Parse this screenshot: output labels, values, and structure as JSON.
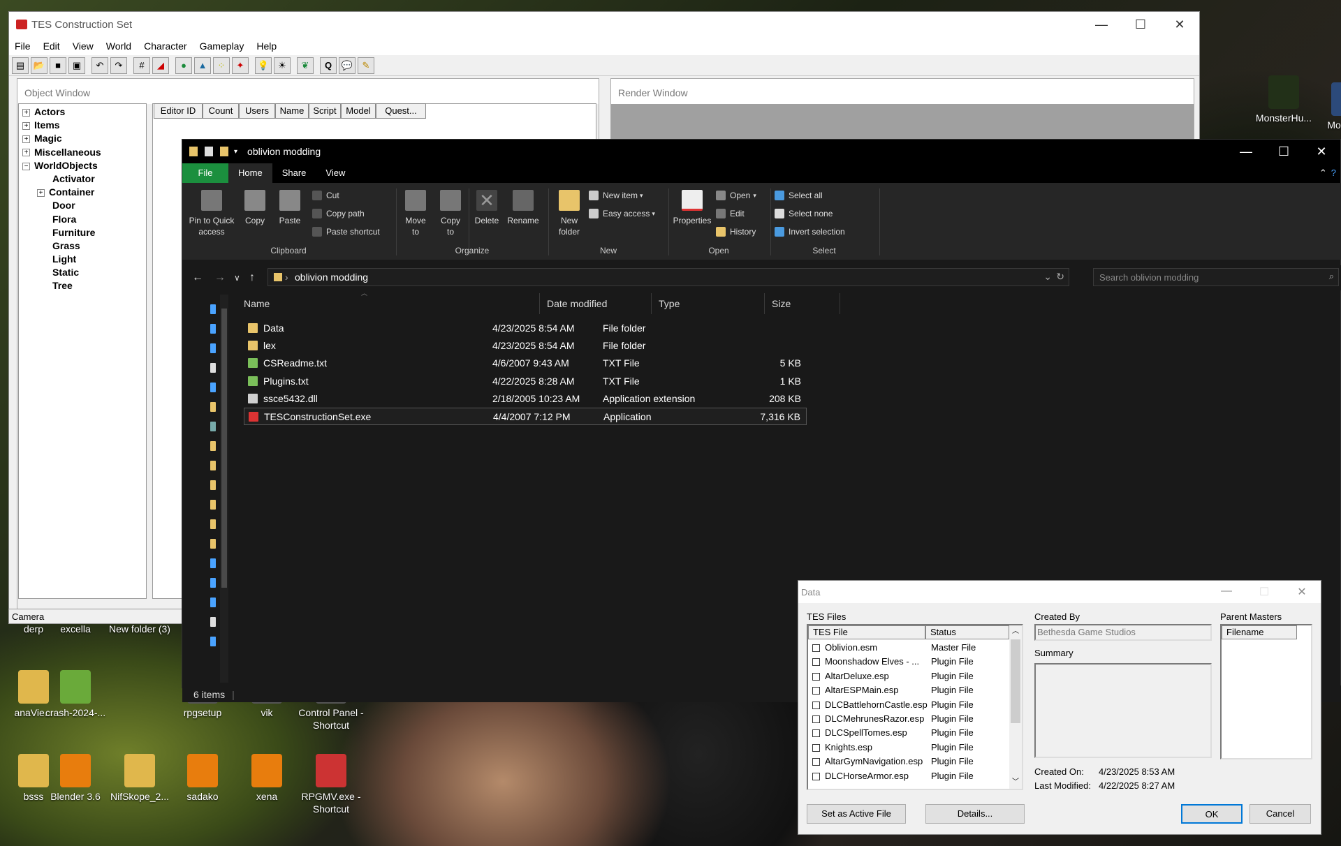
{
  "desktop": {
    "icons": [
      {
        "label": "MonsterHu...",
        "color": "#223018"
      },
      {
        "label": "Mons Sh",
        "color": "#2c4a7a"
      },
      {
        "label": "derp",
        "color": "#444"
      },
      {
        "label": "excella",
        "color": "#555"
      },
      {
        "label": "New folder (3)",
        "color": "#e0b74c"
      },
      {
        "label": "anaVie...",
        "color": "#e0b74c"
      },
      {
        "label": "crash-2024-...",
        "color": "#6aaa3a"
      },
      {
        "label": "rpgsetup",
        "color": "#555"
      },
      {
        "label": "vik",
        "color": "#555"
      },
      {
        "label": "Control Panel - Shortcut",
        "color": "#555"
      },
      {
        "label": "bsss",
        "color": "#e0b74c"
      },
      {
        "label": "Blender 3.6",
        "color": "#e87d0d"
      },
      {
        "label": "NifSkope_2...",
        "color": "#e0b74c"
      },
      {
        "label": "sadako",
        "color": "#e87d0d"
      },
      {
        "label": "xena",
        "color": "#e87d0d"
      },
      {
        "label": "RPGMV.exe - Shortcut",
        "color": "#c33"
      }
    ]
  },
  "tes": {
    "title": "TES Construction Set",
    "menu": [
      "File",
      "Edit",
      "View",
      "World",
      "Character",
      "Gameplay",
      "Help"
    ],
    "object_window_title": "Object Window",
    "render_window_title": "Render Window",
    "tree": [
      {
        "label": "Actors",
        "pm": "+",
        "child": false
      },
      {
        "label": "Items",
        "pm": "+",
        "child": false
      },
      {
        "label": "Magic",
        "pm": "+",
        "child": false
      },
      {
        "label": "Miscellaneous",
        "pm": "+",
        "child": false
      },
      {
        "label": "WorldObjects",
        "pm": "−",
        "child": false
      },
      {
        "label": "Activator",
        "pm": "",
        "child": true
      },
      {
        "label": "Container",
        "pm": "+",
        "child": true
      },
      {
        "label": "Door",
        "pm": "",
        "child": true
      },
      {
        "label": "Flora",
        "pm": "",
        "child": true
      },
      {
        "label": "Furniture",
        "pm": "",
        "child": true
      },
      {
        "label": "Grass",
        "pm": "",
        "child": true
      },
      {
        "label": "Light",
        "pm": "",
        "child": true
      },
      {
        "label": "Static",
        "pm": "",
        "child": true
      },
      {
        "label": "Tree",
        "pm": "",
        "child": true
      }
    ],
    "columns": [
      "Editor ID",
      "Count",
      "Users",
      "Name",
      "Script",
      "Model",
      "Quest..."
    ],
    "status_camera": "Camera"
  },
  "explorer": {
    "title": "oblivion modding",
    "tabs": [
      "File",
      "Home",
      "Share",
      "View"
    ],
    "ribbon": {
      "pin": "Pin to Quick access",
      "copy": "Copy",
      "paste": "Paste",
      "cut": "Cut",
      "copy_path": "Copy path",
      "paste_shortcut": "Paste shortcut",
      "clipboard": "Clipboard",
      "move_to": "Move to",
      "copy_to": "Copy to",
      "delete": "Delete",
      "rename": "Rename",
      "organize": "Organize",
      "new_folder": "New folder",
      "new_item": "New item",
      "easy_access": "Easy access",
      "new": "New",
      "properties": "Properties",
      "open": "Open",
      "edit": "Edit",
      "history": "History",
      "open_group": "Open",
      "select_all": "Select all",
      "select_none": "Select none",
      "invert_selection": "Invert selection",
      "select_group": "Select"
    },
    "address": "oblivion modding",
    "search_placeholder": "Search oblivion modding",
    "headers": {
      "name": "Name",
      "date": "Date modified",
      "type": "Type",
      "size": "Size"
    },
    "files": [
      {
        "name": "Data",
        "date": "4/23/2025 8:54 AM",
        "type": "File folder",
        "size": "",
        "icon": "#e8c46a"
      },
      {
        "name": "lex",
        "date": "4/23/2025 8:54 AM",
        "type": "File folder",
        "size": "",
        "icon": "#e8c46a"
      },
      {
        "name": "CSReadme.txt",
        "date": "4/6/2007 9:43 AM",
        "type": "TXT File",
        "size": "5 KB",
        "icon": "#7bbf5a"
      },
      {
        "name": "Plugins.txt",
        "date": "4/22/2025 8:28 AM",
        "type": "TXT File",
        "size": "1 KB",
        "icon": "#7bbf5a"
      },
      {
        "name": "ssce5432.dll",
        "date": "2/18/2005 10:23 AM",
        "type": "Application extension",
        "size": "208 KB",
        "icon": "#cfcfcf"
      },
      {
        "name": "TESConstructionSet.exe",
        "date": "4/4/2007 7:12 PM",
        "type": "Application",
        "size": "7,316 KB",
        "icon": "#d33"
      }
    ],
    "status": "6 items"
  },
  "dialog": {
    "title": "Data",
    "tes_files_label": "TES Files",
    "col_file": "TES File",
    "col_status": "Status",
    "files": [
      {
        "name": "Oblivion.esm",
        "status": "Master File"
      },
      {
        "name": "Moonshadow Elves - ...",
        "status": "Plugin File"
      },
      {
        "name": "AltarDeluxe.esp",
        "status": "Plugin File"
      },
      {
        "name": "AltarESPMain.esp",
        "status": "Plugin File"
      },
      {
        "name": "DLCBattlehornCastle.esp",
        "status": "Plugin File"
      },
      {
        "name": "DLCMehrunesRazor.esp",
        "status": "Plugin File"
      },
      {
        "name": "DLCSpellTomes.esp",
        "status": "Plugin File"
      },
      {
        "name": "Knights.esp",
        "status": "Plugin File"
      },
      {
        "name": "AltarGymNavigation.esp",
        "status": "Plugin File"
      },
      {
        "name": "DLCHorseArmor.esp",
        "status": "Plugin File"
      }
    ],
    "created_by_label": "Created By",
    "created_by": "Bethesda Game Studios",
    "summary_label": "Summary",
    "created_on_label": "Created On:",
    "created_on": "4/23/2025  8:53 AM",
    "last_modified_label": "Last Modified:",
    "last_modified": "4/22/2025  8:27 AM",
    "parent_masters_label": "Parent Masters",
    "filename_col": "Filename",
    "set_active": "Set as Active File",
    "details": "Details...",
    "ok": "OK",
    "cancel": "Cancel"
  }
}
